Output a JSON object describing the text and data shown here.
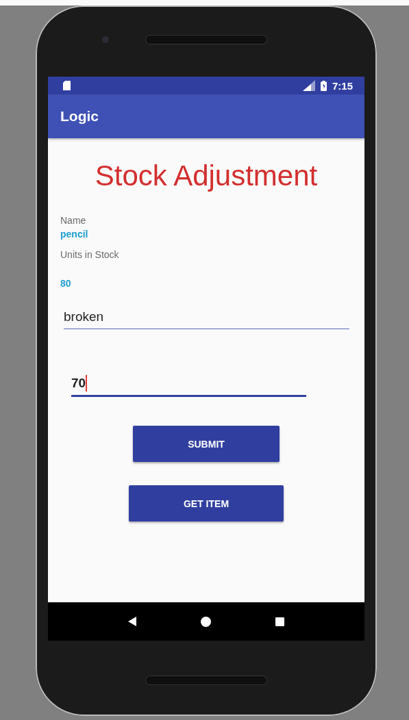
{
  "status_bar": {
    "time": "7:15"
  },
  "app_bar": {
    "title": "Logic"
  },
  "heading": "Stock Adjustment",
  "fields": [
    {
      "label": "Name",
      "value": "pencil"
    },
    {
      "label": "Units in Stock",
      "value": "80"
    }
  ],
  "inputs": [
    {
      "value": "broken",
      "focused": false
    },
    {
      "value": "70",
      "focused": true
    }
  ],
  "buttons": [
    "SUBMIT",
    "GET ITEM"
  ]
}
